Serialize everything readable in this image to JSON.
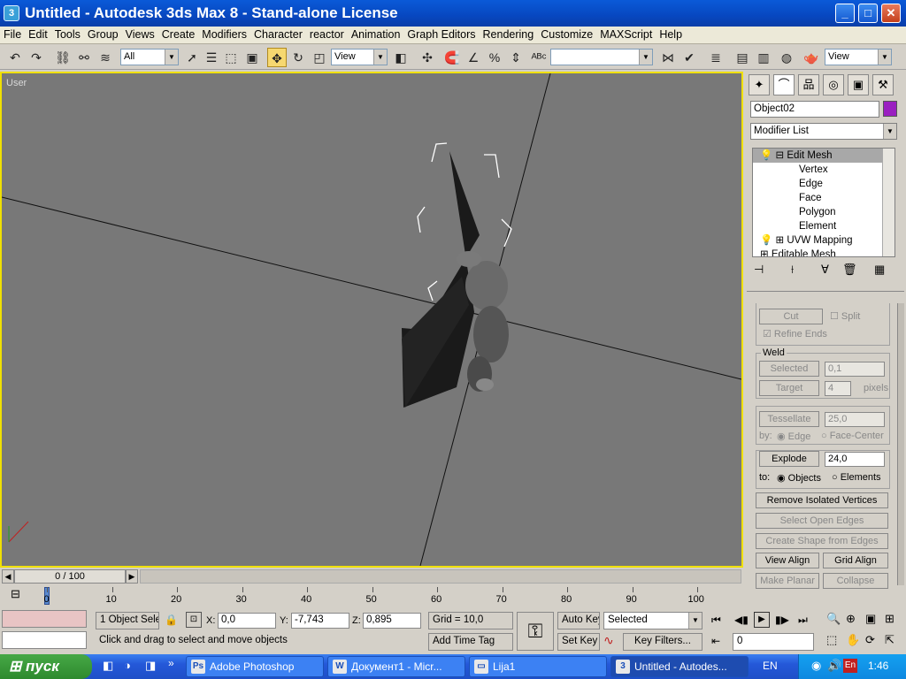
{
  "window": {
    "title": "Untitled - Autodesk 3ds Max 8  - Stand-alone License",
    "min": "_",
    "max": "□",
    "close": "✕"
  },
  "menu": [
    "File",
    "Edit",
    "Tools",
    "Group",
    "Views",
    "Create",
    "Modifiers",
    "Character",
    "reactor",
    "Animation",
    "Graph Editors",
    "Rendering",
    "Customize",
    "MAXScript",
    "Help"
  ],
  "toolbar": {
    "selection_filter": "All",
    "ref_coord": "View",
    "named_selection": "",
    "render_view": "View"
  },
  "viewport": {
    "label": "User"
  },
  "panel": {
    "object_name": "Object02",
    "object_color": "#9a1fc0",
    "modifier_list": "Modifier List",
    "stack": [
      {
        "label": "Edit Mesh",
        "level": 0,
        "selected": true
      },
      {
        "label": "Vertex",
        "level": 1
      },
      {
        "label": "Edge",
        "level": 1
      },
      {
        "label": "Face",
        "level": 1
      },
      {
        "label": "Polygon",
        "level": 1
      },
      {
        "label": "Element",
        "level": 1
      },
      {
        "label": "UVW Mapping",
        "level": 0
      },
      {
        "label": "Editable Mesh",
        "level": 0
      }
    ],
    "cut": "Cut",
    "split": "Split",
    "refine_ends": "Refine Ends",
    "weld": "Weld",
    "selected_btn": "Selected",
    "selected_val": "0,1",
    "target_btn": "Target",
    "target_val": "4",
    "pixels": "pixels",
    "tessellate": "Tessellate",
    "tess_val": "25,0",
    "by": "by:",
    "edge": "Edge",
    "face_center": "Face-Center",
    "explode": "Explode",
    "explode_val": "24,0",
    "to": "to:",
    "objects": "Objects",
    "elements": "Elements",
    "remove_isolated": "Remove Isolated Vertices",
    "select_open_edges": "Select Open Edges",
    "create_shape": "Create Shape from Edges",
    "view_align": "View Align",
    "grid_align": "Grid Align",
    "make_planar": "Make Planar",
    "collapse": "Collapse"
  },
  "timeline": {
    "frame": "0 / 100",
    "ticks": [
      "0",
      "10",
      "20",
      "30",
      "40",
      "50",
      "60",
      "70",
      "80",
      "90",
      "100"
    ]
  },
  "status": {
    "selection": "1 Object Sele",
    "x_label": "X:",
    "x": "0,0",
    "y_label": "Y:",
    "y": "-7,743",
    "z_label": "Z:",
    "z": "0,895",
    "grid": "Grid = 10,0",
    "prompt": "Click and drag to select and move objects",
    "add_time_tag": "Add Time Tag",
    "auto_key": "Auto Key",
    "set_key": "Set Key",
    "key_mode": "Selected",
    "key_filters": "Key Filters...",
    "frame_field": "0"
  },
  "taskbar": {
    "start": "пуск",
    "tasks": [
      {
        "label": "Adobe Photoshop",
        "icon": "Ps"
      },
      {
        "label": "Документ1 - Micr...",
        "icon": "W"
      },
      {
        "label": "Lija1",
        "icon": "▭"
      },
      {
        "label": "Untitled - Autodes...",
        "icon": "3",
        "active": true
      }
    ],
    "lang": "EN",
    "clock": "1:46"
  }
}
